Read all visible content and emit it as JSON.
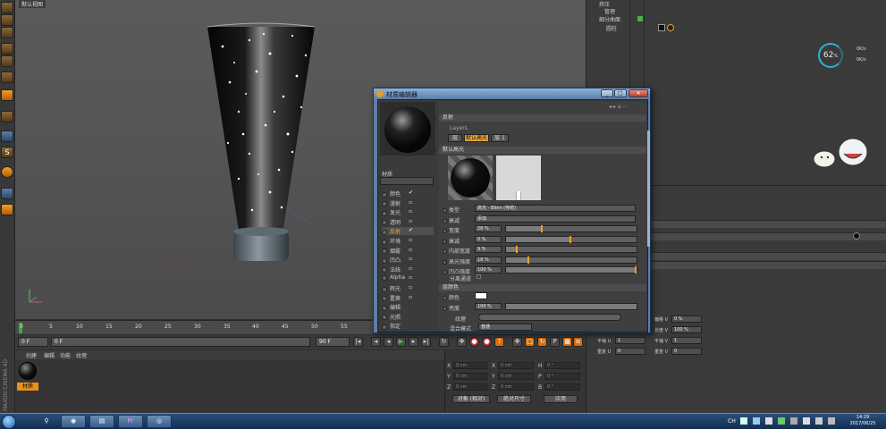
{
  "viewport": {
    "title": "默认视图"
  },
  "timeline": {
    "ticks": [
      "0",
      "5",
      "10",
      "15",
      "20",
      "25",
      "30",
      "35",
      "40",
      "45",
      "50",
      "55"
    ]
  },
  "transport": {
    "start_frame": "0 F",
    "current_frame": "0 F",
    "end_frame": "90 F"
  },
  "material_manager": {
    "menu": [
      "创建",
      "编辑",
      "功能",
      "纹理"
    ],
    "material_label": "材质"
  },
  "app_logo": "MAXON CINEMA 4D",
  "coords": {
    "rows": [
      {
        "axis": "X",
        "pos": "0 cm",
        "size": "0 cm",
        "rot_label": "H",
        "rot": "0 °"
      },
      {
        "axis": "Y",
        "pos": "0 cm",
        "size": "0 cm",
        "rot_label": "P",
        "rot": "0 °"
      },
      {
        "axis": "Z",
        "pos": "0 cm",
        "size": "0 cm",
        "rot_label": "B",
        "rot": "0 °"
      }
    ],
    "mode_select": "对象 (相对)",
    "size_select": "绝对尺寸",
    "apply_label": "应用"
  },
  "objects_panel": {
    "rows": [
      "挤压",
      "管理",
      "细分曲面",
      "圆柱"
    ]
  },
  "cpu_meter": {
    "percent": "62",
    "unit": "%",
    "up": "0K/s",
    "down": "0K/s"
  },
  "attributes": {
    "fields": [
      {
        "label": "偏移 V",
        "value": "0 %"
      },
      {
        "label": "长度 V",
        "value": "100 %"
      },
      {
        "label": "平铺 V",
        "value": "1"
      },
      {
        "label": "重复 V",
        "value": "0"
      },
      {
        "label": "平铺 U",
        "value": "1"
      },
      {
        "label": "重复 U",
        "value": "0"
      }
    ]
  },
  "material_editor": {
    "title": "材质编辑器",
    "material_name": "材质",
    "channels": [
      {
        "name": "颜色",
        "checked": true,
        "active": false
      },
      {
        "name": "漫射",
        "checked": false,
        "active": false
      },
      {
        "name": "发光",
        "checked": false,
        "active": false
      },
      {
        "name": "透明",
        "checked": false,
        "active": false
      },
      {
        "name": "反射",
        "checked": true,
        "active": true
      },
      {
        "name": "环境",
        "checked": false,
        "active": false
      },
      {
        "name": "烟雾",
        "checked": false,
        "active": false
      },
      {
        "name": "凹凸",
        "checked": false,
        "active": false
      },
      {
        "name": "法线",
        "checked": false,
        "active": false
      },
      {
        "name": "Alpha",
        "checked": false,
        "active": false
      },
      {
        "name": "辉光",
        "checked": false,
        "active": false
      },
      {
        "name": "置换",
        "checked": false,
        "active": false
      },
      {
        "name": "编辑",
        "checked": null,
        "active": false
      },
      {
        "name": "光照",
        "checked": null,
        "active": false
      },
      {
        "name": "指定",
        "checked": null,
        "active": false
      }
    ],
    "section_title": "反射",
    "layers_label": "Layers",
    "layer_tabs": [
      "层",
      "默认高光",
      "层 1"
    ],
    "default_spec_header": "默认高光",
    "props": [
      {
        "label": "类型",
        "value": "高光 - Blinn (传统)",
        "kind": "dropdown"
      },
      {
        "label": "衰减",
        "value": "添加",
        "kind": "dropdown"
      },
      {
        "label": "宽度",
        "value": "28 %",
        "kind": "slider",
        "fraction": 0.28
      },
      {
        "label": "衰减",
        "value": "0 %",
        "kind": "slider",
        "fraction": 0.5
      },
      {
        "label": "内部宽度",
        "value": "9 %",
        "kind": "slider",
        "fraction": 0.09
      },
      {
        "label": "高光强度",
        "value": "18 %",
        "kind": "slider",
        "fraction": 0.18
      },
      {
        "label": "凹凸强度",
        "value": "100 %",
        "kind": "slider",
        "fraction": 1.0
      }
    ],
    "separate_pass_label": "分离通道",
    "layer_color_header": "层颜色",
    "color_label": "颜色",
    "brightness_label": "亮度",
    "brightness_value": "100 %",
    "texture_label": "纹理",
    "blend_mode_label": "混合模式",
    "blend_mode_value": "普通"
  },
  "taskbar": {
    "time": "14:29",
    "date": "2017/06/25",
    "lang": "CH"
  }
}
